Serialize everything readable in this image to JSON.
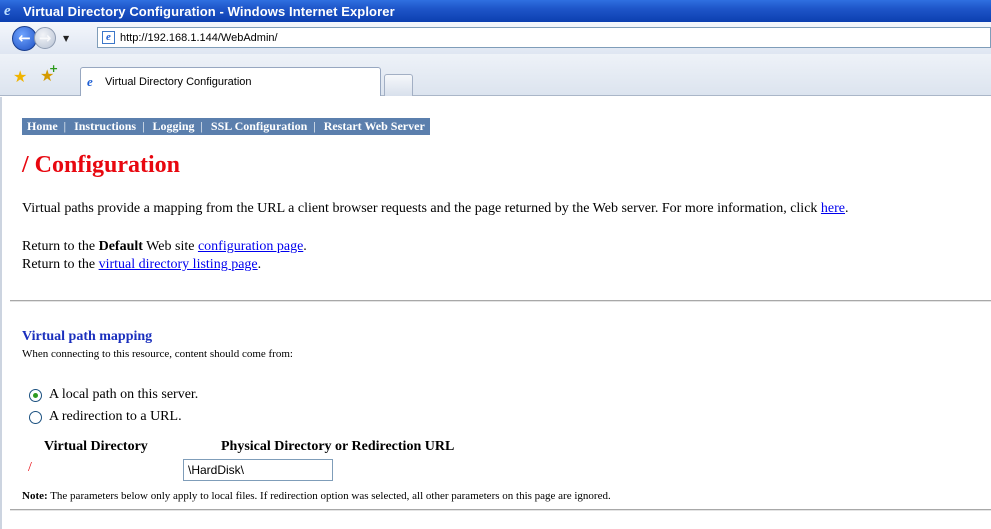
{
  "window": {
    "title": "Virtual Directory Configuration - Windows Internet Explorer"
  },
  "address_bar": {
    "url": "http://192.168.1.144/WebAdmin/"
  },
  "tabs": [
    {
      "label": "Virtual Directory Configuration",
      "active": true
    }
  ],
  "nav": {
    "items": [
      "Home",
      "Instructions",
      "Logging",
      "SSL Configuration",
      "Restart Web Server"
    ],
    "separator": "|"
  },
  "page": {
    "title": "/ Configuration",
    "intro_text": "Virtual paths provide a mapping from the URL a client browser requests and the page returned by the Web server. For more information, click ",
    "intro_link": "here",
    "intro_end": ".",
    "return1_prefix": "Return to the ",
    "return1_bold": "Default",
    "return1_mid": " Web site ",
    "return1_link": "configuration page",
    "return1_end": ".",
    "return2_prefix": "Return to the ",
    "return2_link": "virtual directory listing page",
    "return2_end": "."
  },
  "mapping": {
    "section_title": "Virtual path mapping",
    "subtitle": "When connecting to this resource, content should come from:",
    "options": [
      {
        "label": "A local path on this server.",
        "checked": true
      },
      {
        "label": "A redirection to a URL.",
        "checked": false
      }
    ],
    "col_virtual": "Virtual Directory",
    "col_physical": "Physical Directory or Redirection URL",
    "virtual_dir": "/",
    "physical_path": "\\HardDisk\\",
    "note_label": "Note:",
    "note_text": " The parameters below only apply to local files. If redirection option was selected, all other parameters on this page are ignored."
  },
  "colors": {
    "title_red": "#e8070f",
    "section_blue": "#1a2fbd",
    "nav_bg": "#5b7fad",
    "link": "#0000ee",
    "radio_dot": "#2f9a1f"
  }
}
